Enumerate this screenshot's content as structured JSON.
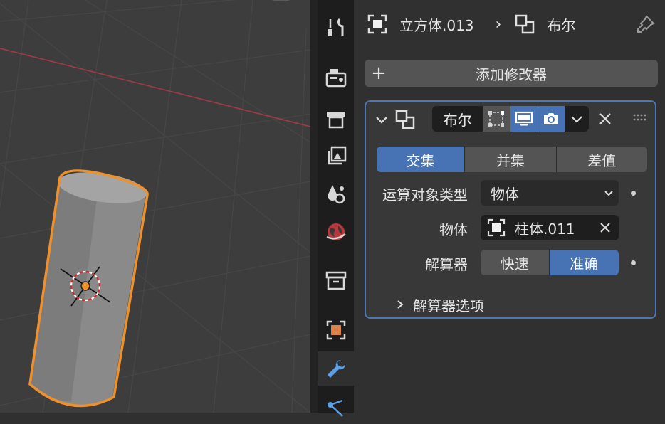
{
  "header": {
    "object_name": "立方体.013",
    "modifier_name": "布尔"
  },
  "add_modifier": {
    "label": "添加修改器"
  },
  "modifier": {
    "name": "布尔",
    "operations": [
      {
        "label": "交集",
        "active": true
      },
      {
        "label": "并集",
        "active": false
      },
      {
        "label": "差值",
        "active": false
      }
    ],
    "operand_type": {
      "label": "运算对象类型",
      "value": "物体"
    },
    "object": {
      "label": "物体",
      "value": "柱体.011"
    },
    "solver": {
      "label": "解算器",
      "options": [
        {
          "label": "快速",
          "active": false
        },
        {
          "label": "准确",
          "active": true
        }
      ]
    },
    "solver_options": {
      "label": "解算器选项"
    }
  },
  "tabs": [
    {
      "name": "tool-tab-icon",
      "active": false
    },
    {
      "name": "render-tab-icon",
      "active": false
    },
    {
      "name": "output-tab-icon",
      "active": false
    },
    {
      "name": "view-layer-tab-icon",
      "active": false
    },
    {
      "name": "scene-tab-icon",
      "active": false
    },
    {
      "name": "world-tab-icon",
      "active": false
    },
    {
      "name": "collection-tab-icon",
      "active": false
    },
    {
      "name": "object-tab-icon",
      "active": false
    },
    {
      "name": "modifier-tab-icon",
      "active": true
    },
    {
      "name": "particles-tab-icon",
      "active": false
    }
  ],
  "colors": {
    "accent": "#4772b3",
    "selection_outline": "#f0902a",
    "panel_bg": "#303030",
    "viewport_bg": "#3d3d3d"
  }
}
